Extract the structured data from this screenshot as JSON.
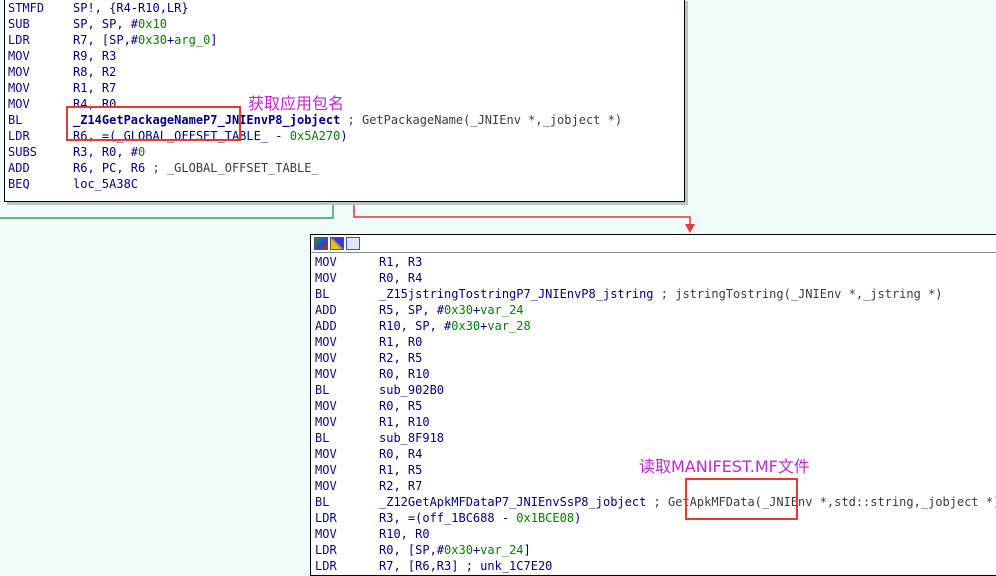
{
  "block1": {
    "lines": [
      {
        "m": "STMFD",
        "o": [
          {
            "t": "SP!, {R4-R10,LR}"
          }
        ]
      },
      {
        "m": "SUB",
        "o": [
          {
            "t": "SP, SP, #"
          },
          {
            "t": "0x10",
            "c": "c-num"
          }
        ]
      },
      {
        "m": "LDR",
        "o": [
          {
            "t": "R7, [SP,#"
          },
          {
            "t": "0x30",
            "c": "c-num"
          },
          {
            "t": "+"
          },
          {
            "t": "arg_0",
            "c": "c-var"
          },
          {
            "t": "]"
          }
        ]
      },
      {
        "m": "MOV",
        "o": [
          {
            "t": "R9, R3"
          }
        ]
      },
      {
        "m": "MOV",
        "o": [
          {
            "t": "R8, R2"
          }
        ]
      },
      {
        "m": "MOV",
        "o": [
          {
            "t": "R1, R7"
          }
        ]
      },
      {
        "m": "MOV",
        "o": [
          {
            "t": "R4, R0"
          }
        ]
      },
      {
        "m": "BL",
        "o": [
          {
            "t": "_Z14GetPackageNameP7_JNIEnvP8_jobject",
            "c": "c-sym c-bold"
          },
          {
            "t": " ; GetPackageName(_JNIEnv *,_jobject *)",
            "c": "c-cmt"
          }
        ]
      },
      {
        "m": "LDR",
        "o": [
          {
            "t": "R6, =("
          },
          {
            "t": "_GLOBAL_OFFSET_TABLE_",
            "c": "c-sym"
          },
          {
            "t": " - "
          },
          {
            "t": "0x5A270",
            "c": "c-num"
          },
          {
            "t": ")"
          }
        ]
      },
      {
        "m": "SUBS",
        "o": [
          {
            "t": "R3, R0, #"
          },
          {
            "t": "0",
            "c": "c-num"
          }
        ]
      },
      {
        "m": "ADD",
        "o": [
          {
            "t": "R6, PC, R6 "
          },
          {
            "t": "; _GLOBAL_OFFSET_TABLE_",
            "c": "c-cmt"
          }
        ]
      },
      {
        "m": "BEQ",
        "o": [
          {
            "t": "loc_5A38C"
          }
        ]
      }
    ]
  },
  "block2": {
    "lines": [
      {
        "m": "MOV",
        "o": [
          {
            "t": "R1, R3"
          }
        ]
      },
      {
        "m": "MOV",
        "o": [
          {
            "t": "R0, R4"
          }
        ]
      },
      {
        "m": "BL",
        "o": [
          {
            "t": "_Z15jstringTostringP7_JNIEnvP8_jstring",
            "c": "c-sym"
          },
          {
            "t": " ; jstringTostring(_JNIEnv *,_jstring *)",
            "c": "c-cmt"
          }
        ]
      },
      {
        "m": "ADD",
        "o": [
          {
            "t": "R5, SP, #"
          },
          {
            "t": "0x30",
            "c": "c-num"
          },
          {
            "t": "+"
          },
          {
            "t": "var_24",
            "c": "c-var"
          }
        ]
      },
      {
        "m": "ADD",
        "o": [
          {
            "t": "R10, SP, #"
          },
          {
            "t": "0x30",
            "c": "c-num"
          },
          {
            "t": "+"
          },
          {
            "t": "var_28",
            "c": "c-var"
          }
        ]
      },
      {
        "m": "MOV",
        "o": [
          {
            "t": "R1, R0"
          }
        ]
      },
      {
        "m": "MOV",
        "o": [
          {
            "t": "R2, R5"
          }
        ]
      },
      {
        "m": "MOV",
        "o": [
          {
            "t": "R0, R10"
          }
        ]
      },
      {
        "m": "BL",
        "o": [
          {
            "t": "sub_902B0"
          }
        ]
      },
      {
        "m": "MOV",
        "o": [
          {
            "t": "R0, R5"
          }
        ]
      },
      {
        "m": "MOV",
        "o": [
          {
            "t": "R1, R10"
          }
        ]
      },
      {
        "m": "BL",
        "o": [
          {
            "t": "sub_8F918"
          }
        ]
      },
      {
        "m": "MOV",
        "o": [
          {
            "t": "R0, R4"
          }
        ]
      },
      {
        "m": "MOV",
        "o": [
          {
            "t": "R1, R5"
          }
        ]
      },
      {
        "m": "MOV",
        "o": [
          {
            "t": "R2, R7"
          }
        ]
      },
      {
        "m": "BL",
        "o": [
          {
            "t": "_Z12GetApkMFDataP7_JNIEnvSsP8_jobject",
            "c": "c-sym"
          },
          {
            "t": " ; GetApkMFData(_JNIEnv *,std::string,_jobject *)",
            "c": "c-cmt"
          }
        ]
      },
      {
        "m": "LDR",
        "o": [
          {
            "t": "R3, =(off_1BC688 - "
          },
          {
            "t": "0x1BCE08",
            "c": "c-num"
          },
          {
            "t": ")"
          }
        ]
      },
      {
        "m": "MOV",
        "o": [
          {
            "t": "R10, R0"
          }
        ]
      },
      {
        "m": "LDR",
        "o": [
          {
            "t": "R0, [SP,#"
          },
          {
            "t": "0x30",
            "c": "c-num"
          },
          {
            "t": "+"
          },
          {
            "t": "var_24",
            "c": "c-var"
          },
          {
            "t": "]"
          }
        ]
      },
      {
        "m": "LDR",
        "o": [
          {
            "t": "R7, [R6,R3] ; unk_1C7E20"
          }
        ]
      }
    ]
  },
  "annotations": {
    "package_name": "获取应用包名",
    "manifest": "读取MANIFEST.MF文件"
  },
  "colors": {
    "background": "#f0fbfc",
    "edge_green": "#2ea84a",
    "edge_red": "#e53935",
    "highlight_box": "#e53935",
    "annotation": "#c026d3"
  }
}
